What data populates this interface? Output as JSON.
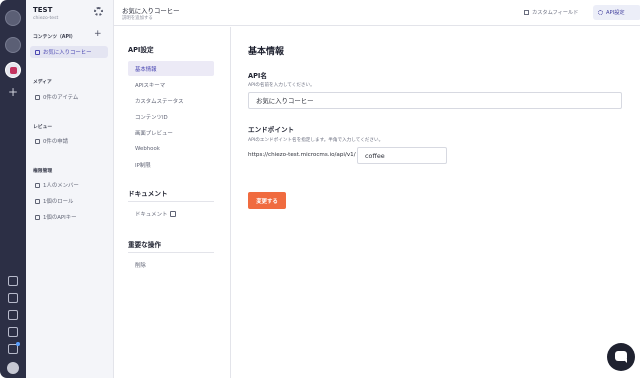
{
  "workspace": {
    "name": "TEST",
    "id": "chiezo-test"
  },
  "sidebar": {
    "contents_section": "コンテンツ（API）",
    "api_item": "お気に入りコーヒー",
    "media_section": "メディア",
    "media_item": "0件のアイテム",
    "review_section": "レビュー",
    "review_item": "0件の申請",
    "perm_section": "権限管理",
    "perm_items": [
      "1人のメンバー",
      "1個のロール",
      "1個のAPIキー"
    ]
  },
  "header": {
    "title": "お気に入りコーヒー",
    "subtitle": "説明を追加する",
    "custom_field": "カスタムフィールド",
    "api_settings": "API設定"
  },
  "menu": {
    "api_heading": "API設定",
    "api_items": [
      "基本情報",
      "APIスキーマ",
      "カスタムステータス",
      "コンテンツID",
      "画面プレビュー",
      "Webhook",
      "IP制限"
    ],
    "doc_heading": "ドキュメント",
    "doc_item": "ドキュメント",
    "danger_heading": "重要な操作",
    "danger_item": "削除"
  },
  "form": {
    "title": "基本情報",
    "name_label": "API名",
    "name_desc": "APIの名前を入力してください。",
    "name_value": "お気に入りコーヒー",
    "endpoint_label": "エンドポイント",
    "endpoint_desc": "APIのエンドポイント名を指定します。半角で入力してください。",
    "endpoint_prefix": "https://chiezo-test.microcms.io/api/v1/",
    "endpoint_value": "coffee",
    "submit": "変更する"
  },
  "colors": {
    "rail": "#2c2f45",
    "accent": "#4a47b2",
    "button": "#f06b3f"
  }
}
